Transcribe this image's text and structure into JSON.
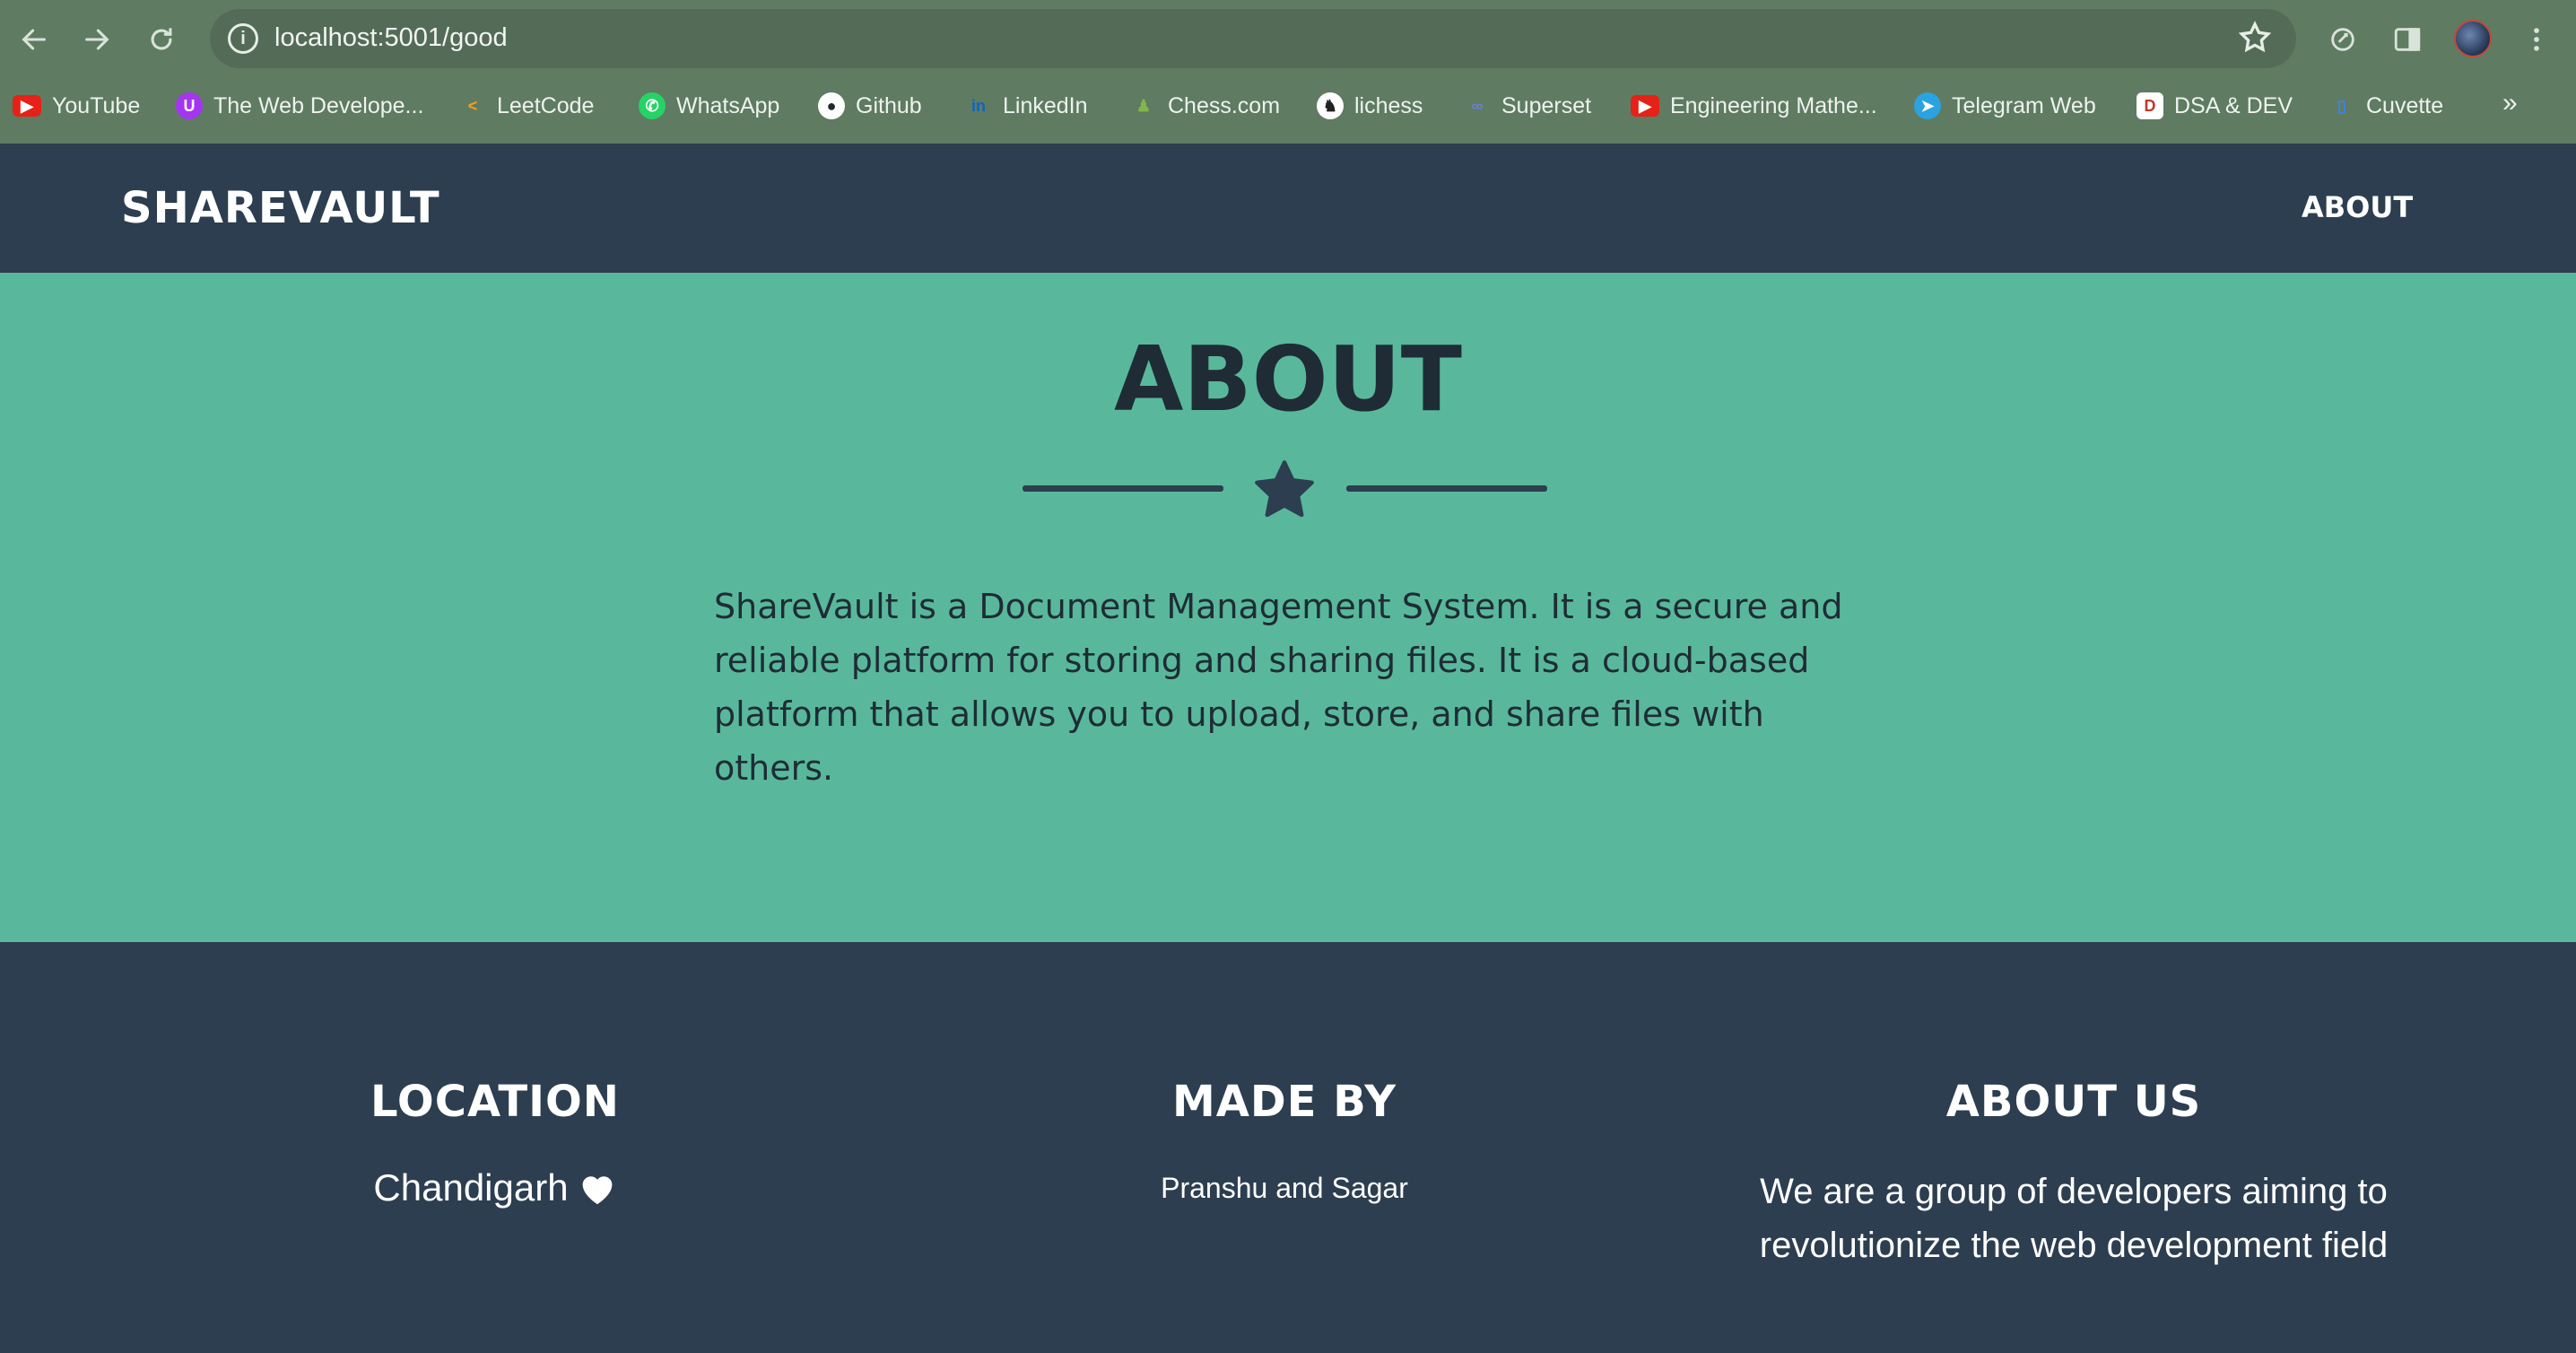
{
  "browser": {
    "url": "localhost:5001/good",
    "bookmarks": [
      {
        "label": "YouTube",
        "icon": "youtube-icon",
        "color": "#e62117"
      },
      {
        "label": "The Web Develope...",
        "icon": "udemy-icon",
        "color": "#a435f0"
      },
      {
        "label": "LeetCode",
        "icon": "leetcode-icon",
        "color": "#f89f1b"
      },
      {
        "label": "WhatsApp",
        "icon": "whatsapp-icon",
        "color": "#25d366"
      },
      {
        "label": "Github",
        "icon": "github-icon",
        "color": "#ffffff"
      },
      {
        "label": "LinkedIn",
        "icon": "linkedin-icon",
        "color": "#0a66c2"
      },
      {
        "label": "Chess.com",
        "icon": "chess-pawn-icon",
        "color": "#81b64c"
      },
      {
        "label": "lichess",
        "icon": "lichess-icon",
        "color": "#ffffff"
      },
      {
        "label": "Superset",
        "icon": "superset-icon",
        "color": "#6b7fd7"
      },
      {
        "label": "Engineering Mathe...",
        "icon": "youtube-icon",
        "color": "#e62117"
      },
      {
        "label": "Telegram Web",
        "icon": "telegram-icon",
        "color": "#2aa3e0"
      },
      {
        "label": "DSA & DEV",
        "icon": "notion-icon",
        "color": "#ffffff"
      },
      {
        "label": "Cuvette",
        "icon": "cuvette-icon",
        "color": "#3b82f6"
      }
    ],
    "more_label": "»"
  },
  "header": {
    "brand": "SHAREVAULT",
    "nav_about": "ABOUT"
  },
  "about": {
    "title": "ABOUT",
    "text": "ShareVault is a Document Management System. It is a secure and reliable platform for storing and sharing files. It is a cloud-based platform that allows you to upload, store, and share files with others."
  },
  "footer": {
    "location_title": "LOCATION",
    "location_text": "Chandigarh",
    "made_by_title": "MADE BY",
    "made_by_text": "Pranshu and Sagar",
    "about_us_title": "ABOUT US",
    "about_us_text": "We are a group of developers aiming to revolutionize the web development field"
  },
  "colors": {
    "header_bg": "#2c3e50",
    "about_bg": "#59b89c",
    "chrome_bg": "#5f7b62"
  }
}
